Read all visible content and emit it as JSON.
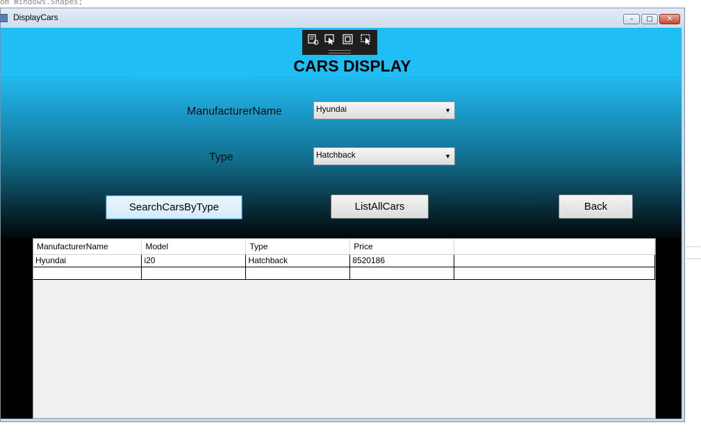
{
  "background": {
    "code_text": "om Windows.Shapes;"
  },
  "window": {
    "title": "DisplayCars",
    "controls": {
      "minimize": "–",
      "maximize": "□",
      "close": "✕"
    }
  },
  "debug_toolbar": {
    "icons": [
      "select-element-icon",
      "pointer-icon",
      "layout-adorner-icon",
      "track-focus-icon"
    ]
  },
  "header": {
    "title": "CARS DISPLAY"
  },
  "form": {
    "manufacturer_label": "ManufacturerName",
    "manufacturer_value": "Hyundai",
    "type_label": "Type",
    "type_value": "Hatchback"
  },
  "buttons": {
    "search": "SearchCarsByType",
    "list_all": "ListAllCars",
    "back": "Back"
  },
  "grid": {
    "columns": [
      "ManufacturerName",
      "Model",
      "Type",
      "Price"
    ],
    "rows": [
      [
        "Hyundai",
        "i20",
        "Hatchback",
        "8520186"
      ],
      [
        "",
        "",
        "",
        ""
      ]
    ]
  },
  "colors": {
    "header_bg": "#1fbff6",
    "accent_focus": "#3c7fb1"
  }
}
